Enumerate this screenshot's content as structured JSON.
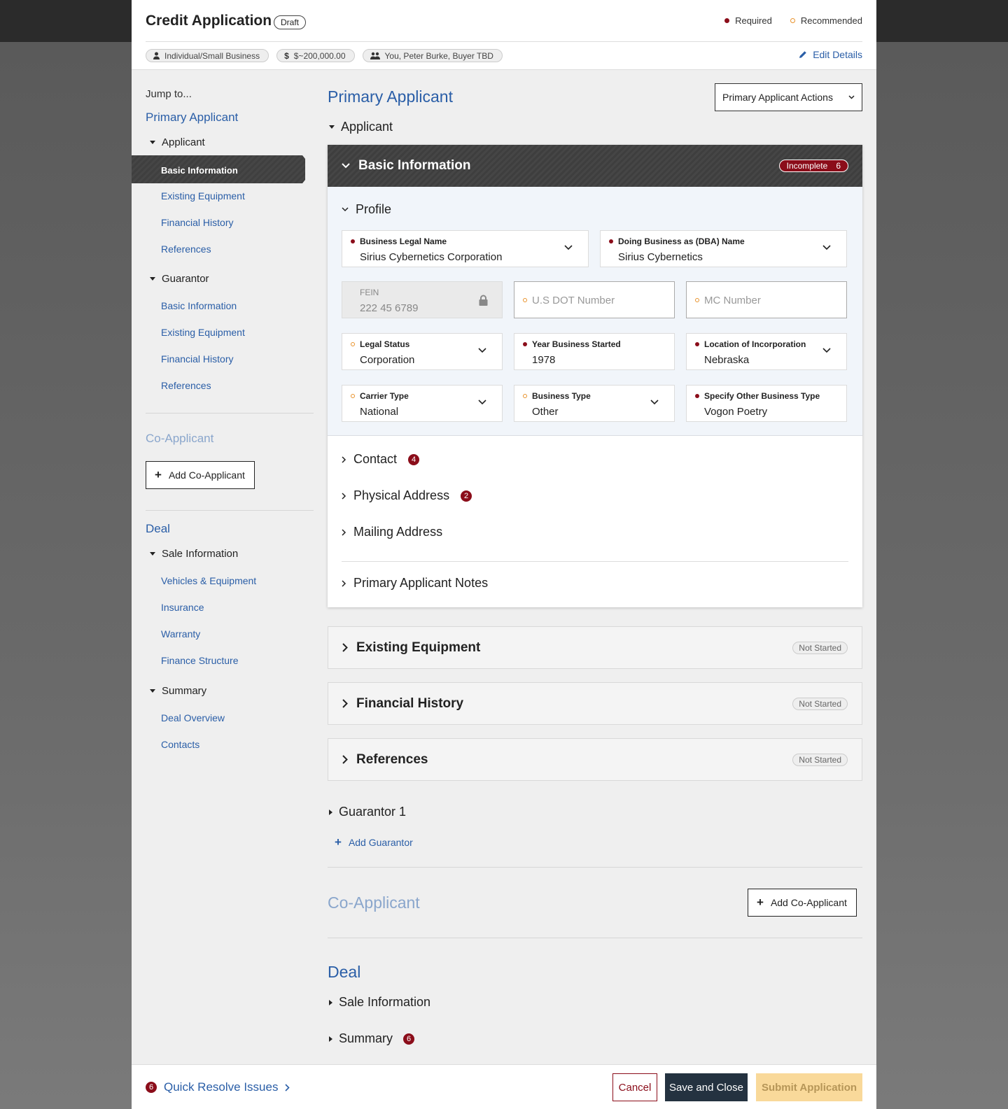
{
  "header": {
    "title": "Credit Application",
    "status": "Draft",
    "legend_required": "Required",
    "legend_recommended": "Recommended",
    "chips": [
      "Individual/Small Business",
      "$~200,000.00",
      "You, Peter Burke, Buyer TBD"
    ],
    "edit": "Edit Details"
  },
  "sidebar": {
    "jump": "Jump to...",
    "primary": "Primary Applicant",
    "applicant": "Applicant",
    "applicant_items": [
      "Basic Information",
      "Existing Equipment",
      "Financial History",
      "References"
    ],
    "guarantor": "Guarantor",
    "guarantor_items": [
      "Basic Information",
      "Existing Equipment",
      "Financial History",
      "References"
    ],
    "coapplicant": "Co-Applicant",
    "add_coapplicant": "Add Co-Applicant",
    "deal": "Deal",
    "sale": "Sale Information",
    "sale_items": [
      "Vehicles & Equipment",
      "Insurance",
      "Warranty",
      "Finance Structure"
    ],
    "summary": "Summary",
    "summary_items": [
      "Deal Overview",
      "Contacts"
    ]
  },
  "main": {
    "primary_title": "Primary Applicant",
    "actions": "Primary Applicant Actions",
    "applicant": "Applicant",
    "basic": {
      "title": "Basic Information",
      "badge": "Incomplete",
      "badge_count": "6"
    },
    "profile": "Profile",
    "fields": {
      "legal_name": {
        "label": "Business Legal Name",
        "value": "Sirius Cybernetics Corporation"
      },
      "dba": {
        "label": "Doing Business as (DBA) Name",
        "value": "Sirius Cybernetics"
      },
      "fein": {
        "label": "FEIN",
        "value": "222 45 6789"
      },
      "dot": {
        "placeholder": "U.S DOT Number"
      },
      "mc": {
        "placeholder": "MC Number"
      },
      "legal_status": {
        "label": "Legal Status",
        "value": "Corporation"
      },
      "year": {
        "label": "Year Business Started",
        "value": "1978"
      },
      "location": {
        "label": "Location of Incorporation",
        "value": "Nebraska"
      },
      "carrier": {
        "label": "Carrier Type",
        "value": "National"
      },
      "btype": {
        "label": "Business Type",
        "value": "Other"
      },
      "other_type": {
        "label": "Specify Other Business Type",
        "value": "Vogon Poetry"
      }
    },
    "contact": "Contact",
    "contact_count": "4",
    "physical": "Physical Address",
    "physical_count": "2",
    "mailing": "Mailing Address",
    "notes": "Primary Applicant Notes",
    "existing": "Existing Equipment",
    "financial": "Financial History",
    "references": "References",
    "not_started": "Not Started",
    "guarantor": "Guarantor 1",
    "add_guarantor": "Add Guarantor",
    "coapplicant": "Co-Applicant",
    "add_coapplicant": "Add Co-Applicant",
    "deal": "Deal",
    "sale": "Sale Information",
    "summary": "Summary",
    "summary_count": "6"
  },
  "footer": {
    "count": "6",
    "quick": "Quick Resolve Issues",
    "cancel": "Cancel",
    "save": "Save and Close",
    "submit": "Submit Application"
  },
  "colors": {
    "brand_blue": "#2a5ea7",
    "required": "#8b0d1a",
    "recommended": "#e8922b",
    "submit": "#f9d99a",
    "dark": "#243240"
  }
}
